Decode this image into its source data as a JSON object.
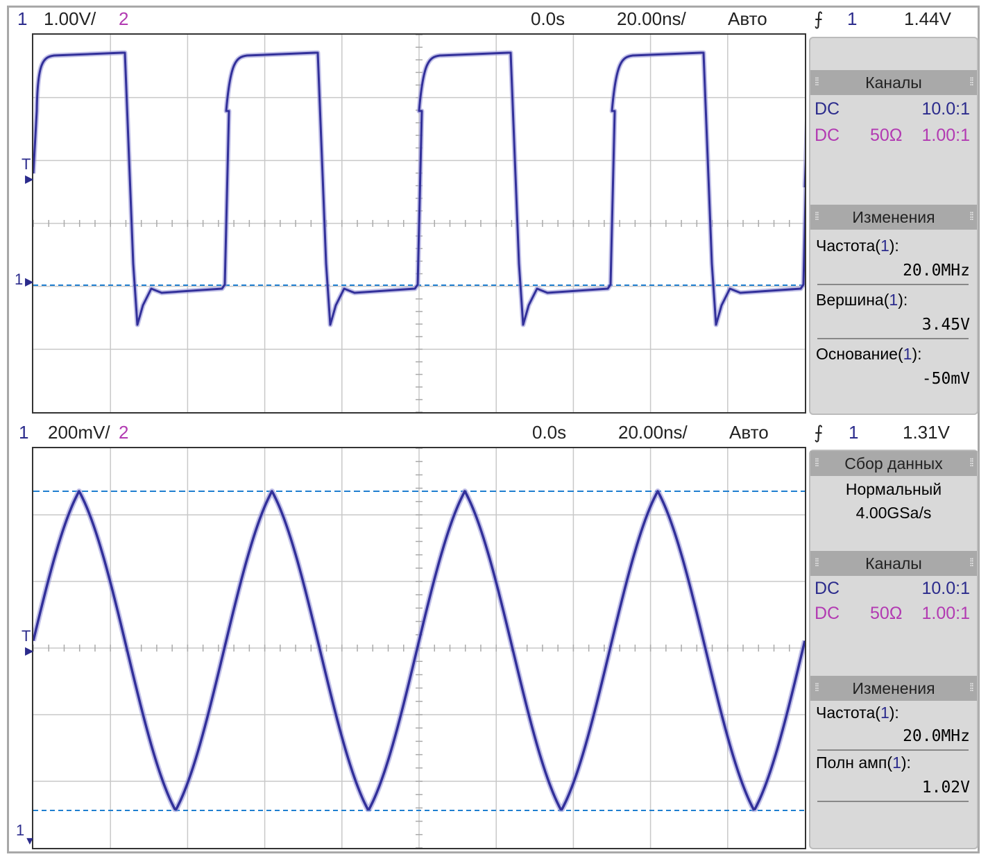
{
  "top": {
    "ch1_num": "1",
    "ch1_scale": "1.00V/",
    "ch2_num": "2",
    "time_offset": "0.0s",
    "timebase": "20.00ns/",
    "mode": "Авто",
    "trig_icon": "trigger-edge-icon",
    "trig_src": "1",
    "trig_level": "1.44V",
    "ch_marker": "1",
    "trig_marker": "T",
    "channels": {
      "title": "Каналы",
      "rows": [
        {
          "coupling": "DC",
          "imp": "",
          "probe": "10.0:1"
        },
        {
          "coupling": "DC",
          "imp": "50Ω",
          "probe": "1.00:1"
        }
      ]
    },
    "measure": {
      "title": "Изменения",
      "items": [
        {
          "name": "Частота",
          "ch": "1",
          "value": "20.0MHz"
        },
        {
          "name": "Вершина",
          "ch": "1",
          "value": "3.45V"
        },
        {
          "name": "Основание",
          "ch": "1",
          "value": "-50mV"
        }
      ]
    }
  },
  "bottom": {
    "ch1_num": "1",
    "ch1_scale": "200mV/",
    "ch2_num": "2",
    "time_offset": "0.0s",
    "timebase": "20.00ns/",
    "mode": "Авто",
    "trig_icon": "trigger-edge-icon",
    "trig_src": "1",
    "trig_level": "1.31V",
    "ch_marker": "1",
    "trig_marker": "T",
    "acq": {
      "title": "Сбор данных",
      "mode": "Нормальный",
      "rate": "4.00GSa/s"
    },
    "channels": {
      "title": "Каналы",
      "rows": [
        {
          "coupling": "DC",
          "imp": "",
          "probe": "10.0:1"
        },
        {
          "coupling": "DC",
          "imp": "50Ω",
          "probe": "1.00:1"
        }
      ]
    },
    "measure": {
      "title": "Изменения",
      "items": [
        {
          "name": "Частота",
          "ch": "1",
          "value": "20.0MHz"
        },
        {
          "name": "Полн амп",
          "ch": "1",
          "value": "1.02V"
        }
      ]
    }
  },
  "colors": {
    "trace": "#32309a",
    "cursor": "#1f7fd0",
    "ch2": "#b23ab2",
    "grid": "#c8c8c8"
  }
}
